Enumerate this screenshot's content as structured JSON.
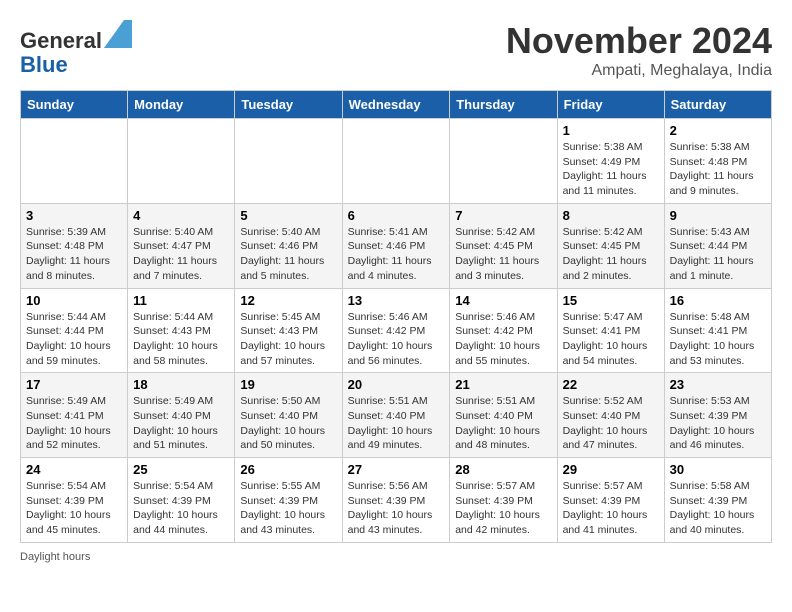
{
  "header": {
    "logo_line1": "General",
    "logo_line2": "Blue",
    "month_title": "November 2024",
    "location": "Ampati, Meghalaya, India"
  },
  "calendar": {
    "days_of_week": [
      "Sunday",
      "Monday",
      "Tuesday",
      "Wednesday",
      "Thursday",
      "Friday",
      "Saturday"
    ],
    "weeks": [
      [
        {
          "day": "",
          "info": ""
        },
        {
          "day": "",
          "info": ""
        },
        {
          "day": "",
          "info": ""
        },
        {
          "day": "",
          "info": ""
        },
        {
          "day": "",
          "info": ""
        },
        {
          "day": "1",
          "info": "Sunrise: 5:38 AM\nSunset: 4:49 PM\nDaylight: 11 hours and 11 minutes."
        },
        {
          "day": "2",
          "info": "Sunrise: 5:38 AM\nSunset: 4:48 PM\nDaylight: 11 hours and 9 minutes."
        }
      ],
      [
        {
          "day": "3",
          "info": "Sunrise: 5:39 AM\nSunset: 4:48 PM\nDaylight: 11 hours and 8 minutes."
        },
        {
          "day": "4",
          "info": "Sunrise: 5:40 AM\nSunset: 4:47 PM\nDaylight: 11 hours and 7 minutes."
        },
        {
          "day": "5",
          "info": "Sunrise: 5:40 AM\nSunset: 4:46 PM\nDaylight: 11 hours and 5 minutes."
        },
        {
          "day": "6",
          "info": "Sunrise: 5:41 AM\nSunset: 4:46 PM\nDaylight: 11 hours and 4 minutes."
        },
        {
          "day": "7",
          "info": "Sunrise: 5:42 AM\nSunset: 4:45 PM\nDaylight: 11 hours and 3 minutes."
        },
        {
          "day": "8",
          "info": "Sunrise: 5:42 AM\nSunset: 4:45 PM\nDaylight: 11 hours and 2 minutes."
        },
        {
          "day": "9",
          "info": "Sunrise: 5:43 AM\nSunset: 4:44 PM\nDaylight: 11 hours and 1 minute."
        }
      ],
      [
        {
          "day": "10",
          "info": "Sunrise: 5:44 AM\nSunset: 4:44 PM\nDaylight: 10 hours and 59 minutes."
        },
        {
          "day": "11",
          "info": "Sunrise: 5:44 AM\nSunset: 4:43 PM\nDaylight: 10 hours and 58 minutes."
        },
        {
          "day": "12",
          "info": "Sunrise: 5:45 AM\nSunset: 4:43 PM\nDaylight: 10 hours and 57 minutes."
        },
        {
          "day": "13",
          "info": "Sunrise: 5:46 AM\nSunset: 4:42 PM\nDaylight: 10 hours and 56 minutes."
        },
        {
          "day": "14",
          "info": "Sunrise: 5:46 AM\nSunset: 4:42 PM\nDaylight: 10 hours and 55 minutes."
        },
        {
          "day": "15",
          "info": "Sunrise: 5:47 AM\nSunset: 4:41 PM\nDaylight: 10 hours and 54 minutes."
        },
        {
          "day": "16",
          "info": "Sunrise: 5:48 AM\nSunset: 4:41 PM\nDaylight: 10 hours and 53 minutes."
        }
      ],
      [
        {
          "day": "17",
          "info": "Sunrise: 5:49 AM\nSunset: 4:41 PM\nDaylight: 10 hours and 52 minutes."
        },
        {
          "day": "18",
          "info": "Sunrise: 5:49 AM\nSunset: 4:40 PM\nDaylight: 10 hours and 51 minutes."
        },
        {
          "day": "19",
          "info": "Sunrise: 5:50 AM\nSunset: 4:40 PM\nDaylight: 10 hours and 50 minutes."
        },
        {
          "day": "20",
          "info": "Sunrise: 5:51 AM\nSunset: 4:40 PM\nDaylight: 10 hours and 49 minutes."
        },
        {
          "day": "21",
          "info": "Sunrise: 5:51 AM\nSunset: 4:40 PM\nDaylight: 10 hours and 48 minutes."
        },
        {
          "day": "22",
          "info": "Sunrise: 5:52 AM\nSunset: 4:40 PM\nDaylight: 10 hours and 47 minutes."
        },
        {
          "day": "23",
          "info": "Sunrise: 5:53 AM\nSunset: 4:39 PM\nDaylight: 10 hours and 46 minutes."
        }
      ],
      [
        {
          "day": "24",
          "info": "Sunrise: 5:54 AM\nSunset: 4:39 PM\nDaylight: 10 hours and 45 minutes."
        },
        {
          "day": "25",
          "info": "Sunrise: 5:54 AM\nSunset: 4:39 PM\nDaylight: 10 hours and 44 minutes."
        },
        {
          "day": "26",
          "info": "Sunrise: 5:55 AM\nSunset: 4:39 PM\nDaylight: 10 hours and 43 minutes."
        },
        {
          "day": "27",
          "info": "Sunrise: 5:56 AM\nSunset: 4:39 PM\nDaylight: 10 hours and 43 minutes."
        },
        {
          "day": "28",
          "info": "Sunrise: 5:57 AM\nSunset: 4:39 PM\nDaylight: 10 hours and 42 minutes."
        },
        {
          "day": "29",
          "info": "Sunrise: 5:57 AM\nSunset: 4:39 PM\nDaylight: 10 hours and 41 minutes."
        },
        {
          "day": "30",
          "info": "Sunrise: 5:58 AM\nSunset: 4:39 PM\nDaylight: 10 hours and 40 minutes."
        }
      ]
    ]
  },
  "footer": {
    "daylight_label": "Daylight hours"
  }
}
